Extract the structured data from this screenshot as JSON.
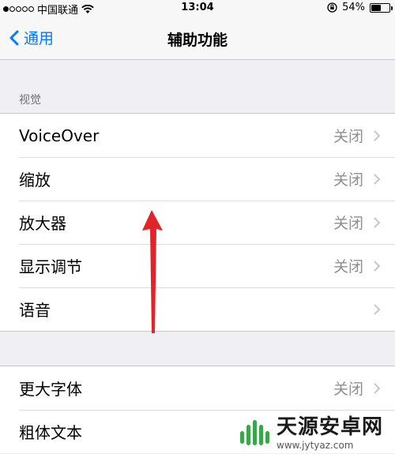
{
  "status_bar": {
    "carrier": "中国联通",
    "time": "13:04",
    "battery_percent": "54%",
    "battery_level": 0.54
  },
  "nav": {
    "back_label": "通用",
    "title": "辅助功能"
  },
  "sections": [
    {
      "header": "视觉",
      "rows": [
        {
          "label": "VoiceOver",
          "value": "关闭"
        },
        {
          "label": "缩放",
          "value": "关闭"
        },
        {
          "label": "放大器",
          "value": "关闭"
        },
        {
          "label": "显示调节",
          "value": "关闭"
        },
        {
          "label": "语音",
          "value": ""
        }
      ]
    },
    {
      "header": "",
      "rows": [
        {
          "label": "更大字体",
          "value": "关闭"
        },
        {
          "label": "粗体文本",
          "value": ""
        }
      ]
    }
  ],
  "watermark": {
    "name": "天源安卓网",
    "url": "www.jytyaz.com"
  },
  "colors": {
    "accent": "#007aff",
    "annotation": "#e0242a",
    "secondary_text": "#8e8e93"
  }
}
